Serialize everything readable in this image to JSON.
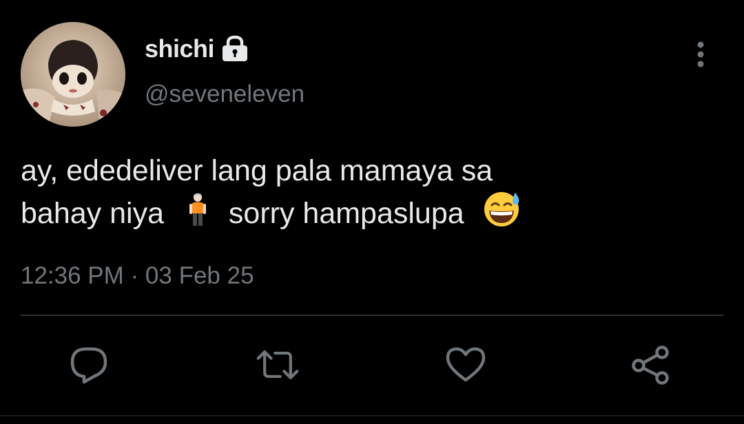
{
  "tweet": {
    "author": {
      "display_name": "shichi",
      "handle": "@seveneleven",
      "protected_icon": "lock-icon",
      "avatar": "profile-avatar"
    },
    "text_line1": "ay, ededeliver lang pala mamaya sa",
    "text_line2_a": "bahay niya",
    "emoji_1": "person-standing-emoji",
    "text_line2_b": "sorry hampaslupa",
    "emoji_2": "grinning-sweat-emoji",
    "timestamp": "12:36 PM · 03 Feb 25"
  },
  "actions": [
    {
      "name": "reply",
      "icon": "comment-icon"
    },
    {
      "name": "retweet",
      "icon": "retweet-icon"
    },
    {
      "name": "like",
      "icon": "heart-icon"
    },
    {
      "name": "share",
      "icon": "share-icon"
    }
  ],
  "colors": {
    "background": "#000000",
    "primary_text": "#e7e9ea",
    "secondary_text": "#71767b",
    "divider": "#2f3336",
    "icon": "#71767b"
  }
}
